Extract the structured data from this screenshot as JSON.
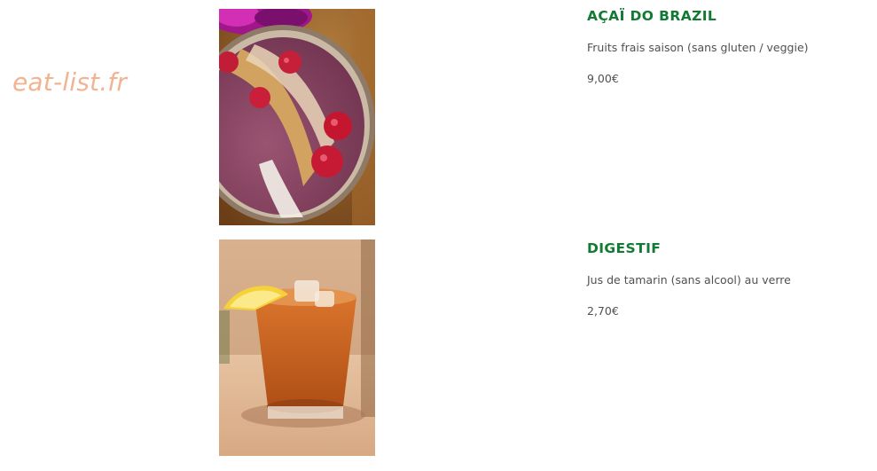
{
  "watermark": {
    "text": "eat-list.fr"
  },
  "items": [
    {
      "name": "AÇAÏ DO BRAZIL",
      "description": "Fruits frais saison (sans gluten / veggie)",
      "price": "9,00€",
      "image_icon": "acai-bowl-photo"
    },
    {
      "name": "DIGESTIF",
      "description": "Jus de tamarin (sans alcool) au verre",
      "price": "2,70€",
      "image_icon": "tamarind-drink-photo"
    }
  ],
  "colors": {
    "item_name": "#127a33",
    "text": "#505050",
    "watermark": "#f2b391"
  }
}
